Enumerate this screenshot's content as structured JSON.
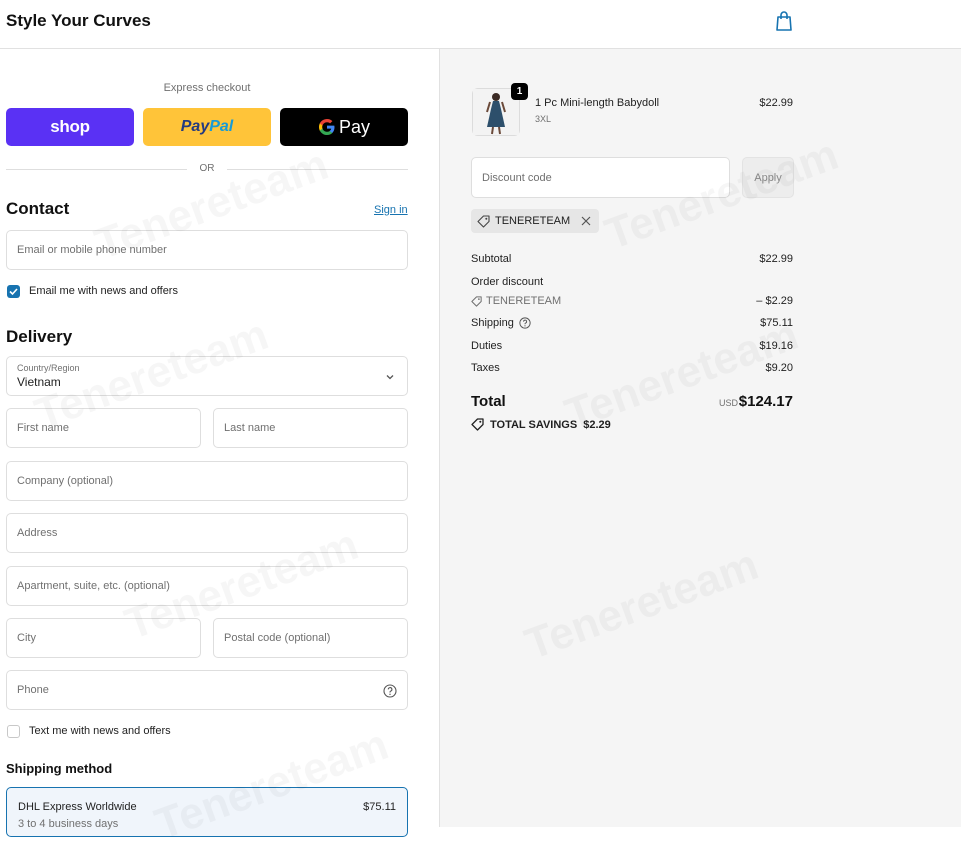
{
  "header": {
    "store_name": "Style Your Curves",
    "cart_icon": "shopping-bag-icon"
  },
  "express": {
    "label": "Express checkout",
    "shop_label": "shop",
    "paypal_part1": "Pay",
    "paypal_part2": "Pal",
    "gpay_label": "Pay",
    "or_label": "OR"
  },
  "contact": {
    "title": "Contact",
    "sign_in": "Sign in",
    "email_placeholder": "Email or mobile phone number",
    "email_news_label": "Email me with news and offers",
    "email_news_checked": true
  },
  "delivery": {
    "title": "Delivery",
    "country_label": "Country/Region",
    "country_value": "Vietnam",
    "first_name": "First name",
    "last_name": "Last name",
    "company": "Company (optional)",
    "address": "Address",
    "apartment": "Apartment, suite, etc. (optional)",
    "city": "City",
    "postal": "Postal code (optional)",
    "phone": "Phone",
    "text_news_label": "Text me with news and offers",
    "text_news_checked": false
  },
  "shipping_method": {
    "title": "Shipping method",
    "option_name": "DHL Express Worldwide",
    "option_price": "$75.11",
    "option_days": "3 to 4 business days"
  },
  "summary": {
    "product": {
      "name": "1 Pc Mini-length Babydoll",
      "variant": "3XL",
      "price": "$22.99",
      "qty": "1"
    },
    "discount_placeholder": "Discount code",
    "apply_label": "Apply",
    "applied_code": "TENERETEAM",
    "subtotal_label": "Subtotal",
    "subtotal_value": "$22.99",
    "order_discount_label": "Order discount",
    "order_discount_code": "TENERETEAM",
    "order_discount_value": "– $2.29",
    "shipping_label": "Shipping",
    "shipping_value": "$75.11",
    "duties_label": "Duties",
    "duties_value": "$19.16",
    "taxes_label": "Taxes",
    "taxes_value": "$9.20",
    "total_label": "Total",
    "total_currency": "USD",
    "total_value": "$124.17",
    "savings_label": "TOTAL SAVINGS",
    "savings_value": "$2.29"
  },
  "watermark_text": "Tenereteam",
  "colors": {
    "shop": "#5a31f4",
    "paypal": "#ffc439",
    "gpay": "#000000",
    "link": "#1773b0"
  }
}
